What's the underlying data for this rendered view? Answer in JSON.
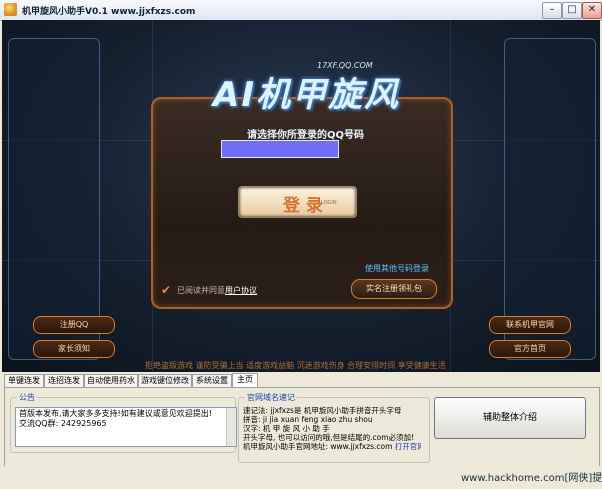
{
  "window": {
    "title": "机甲旋风小助手V0.1 www.jjxfxzs.com",
    "minimize_glyph": "–",
    "maximize_glyph": "□",
    "close_glyph": "✕"
  },
  "login": {
    "logo_text": "AI机甲旋风",
    "logo_sub": "17XF.QQ.COM",
    "choose_label": "请选择你所登录的QQ号码",
    "login_button": "登 录",
    "login_button_sub": "LOGIN",
    "other_login_link": "使用其他号码登录",
    "agree_text": "已阅读并同意",
    "agree_link": "用户协议",
    "realname_button": "实名注册领礼包"
  },
  "side_buttons": {
    "register_qq": "注册QQ",
    "parent_monitor": "家长须知",
    "official_site": "联系机甲官网",
    "official_homepage": "官方首页"
  },
  "health_notice": "拒绝盗版游戏  谨防受骗上当  适度游戏益脑  沉迷游戏伤身  合理安排时间  享受健康生活",
  "tabs": [
    "单键连发",
    "连招连发",
    "自动使用药水",
    "游戏键位修改",
    "系统设置",
    "主页"
  ],
  "notice": {
    "legend": "公告",
    "lines": [
      "首版本发布,请大家多多支持!如有建议或意见欢迎提出!",
      "交流QQ群: 242925965"
    ]
  },
  "website": {
    "legend": "官网域名速记",
    "line1": "速记法: jjxfxzs是 机甲旋风小助手拼音开头字母",
    "line2": "拼音: ji jia xuan feng xiao zhu shou",
    "line3": "汉字: 机  甲  旋  风  小  助  手",
    "line4": "开头字母, 也可以访问的哦,但是结尾的.com必须加!",
    "line5": "机甲旋风小助手官网地址: www.jjxfxzs.com",
    "open_link": "打开官网"
  },
  "intro_button": "辅助整体介绍",
  "watermark": "www.hackhome.com[网侠]提供",
  "colors": {
    "accent_orange": "#e07d1f",
    "link_blue": "#1a3fb5",
    "qq_select": "#6f6ff5"
  }
}
